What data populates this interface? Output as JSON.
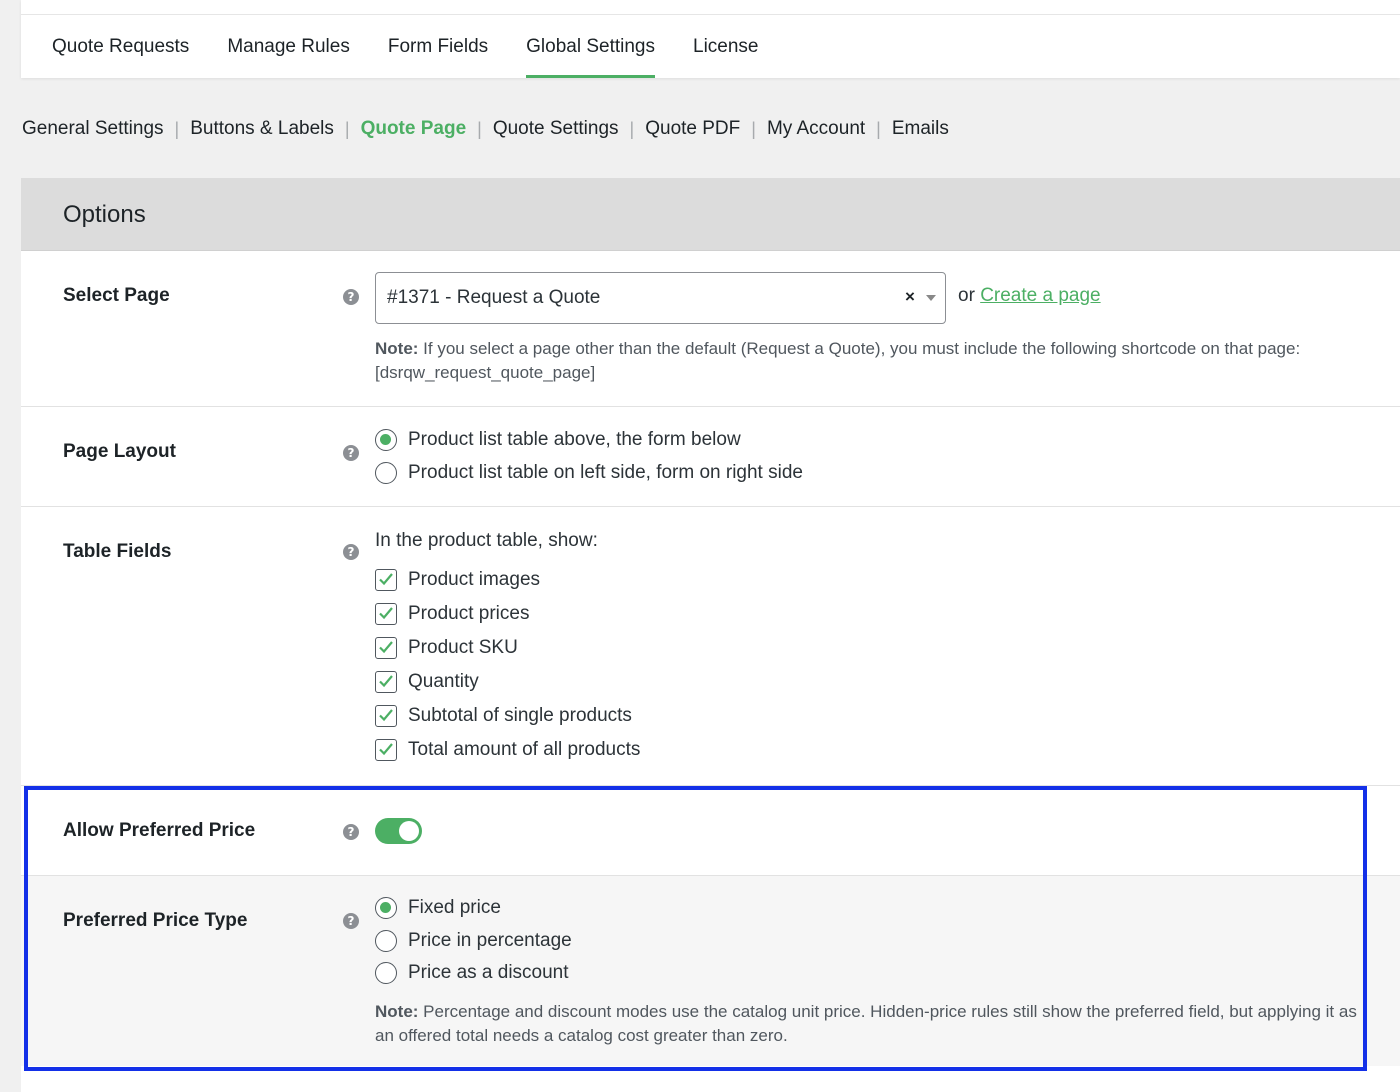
{
  "top_tabs": [
    {
      "label": "Quote Requests"
    },
    {
      "label": "Manage Rules"
    },
    {
      "label": "Form Fields"
    },
    {
      "label": "Global Settings"
    },
    {
      "label": "License"
    }
  ],
  "active_tab": "Global Settings",
  "subnav": [
    {
      "label": "General Settings"
    },
    {
      "label": "Buttons & Labels"
    },
    {
      "label": "Quote Page"
    },
    {
      "label": "Quote Settings"
    },
    {
      "label": "Quote PDF"
    },
    {
      "label": "My Account"
    },
    {
      "label": "Emails"
    }
  ],
  "current_subnav": "Quote Page",
  "panel": {
    "title": "Options",
    "select_page": {
      "label": "Select Page",
      "value": "#1371 - Request a Quote",
      "clear_symbol": "×",
      "or_text": "or",
      "create_link": "Create a page",
      "note_bold": "Note:",
      "note_text": " If you select a page other than the default (Request a Quote), you must include the following shortcode on that page: [dsrqw_request_quote_page]"
    },
    "page_layout": {
      "label": "Page Layout",
      "options": [
        {
          "label": "Product list table above, the form below",
          "checked": true
        },
        {
          "label": "Product list table on left side, form on right side",
          "checked": false
        }
      ]
    },
    "table_fields": {
      "label": "Table Fields",
      "intro": "In the product table, show:",
      "items": [
        {
          "label": "Product images",
          "checked": true
        },
        {
          "label": "Product prices",
          "checked": true
        },
        {
          "label": "Product SKU",
          "checked": true
        },
        {
          "label": "Quantity",
          "checked": true
        },
        {
          "label": "Subtotal of single products",
          "checked": true
        },
        {
          "label": "Total amount of all products",
          "checked": true
        }
      ]
    },
    "allow_preferred_price": {
      "label": "Allow Preferred Price",
      "enabled": true
    },
    "preferred_price_type": {
      "label": "Preferred Price Type",
      "options": [
        {
          "label": "Fixed price",
          "checked": true
        },
        {
          "label": "Price in percentage",
          "checked": false
        },
        {
          "label": "Price as a discount",
          "checked": false
        }
      ],
      "note_bold": "Note:",
      "note_text": " Percentage and discount modes use the catalog unit price. Hidden-price rules still show the preferred field, but applying it as an offered total needs a catalog cost greater than zero."
    }
  },
  "help_symbol": "?",
  "colors": {
    "accent": "#4caf64",
    "highlight_border": "#1330e8",
    "header_bg": "#dcdcdc",
    "page_bg": "#f0f0f0"
  },
  "icons": {
    "help": "question-circle-icon",
    "check": "checkmark-icon",
    "caret": "chevron-down-icon"
  }
}
